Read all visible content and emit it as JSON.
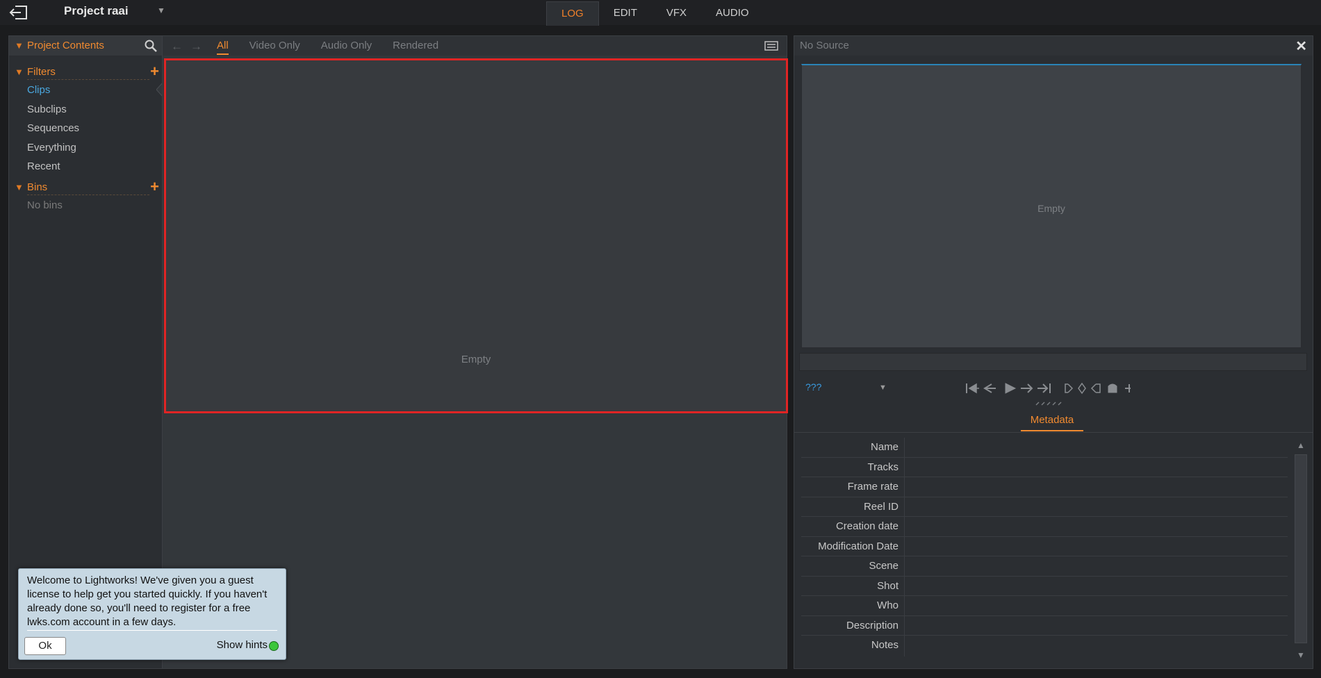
{
  "header": {
    "project_title": "Project raai",
    "tabs": [
      {
        "label": "LOG",
        "active": true
      },
      {
        "label": "EDIT",
        "active": false
      },
      {
        "label": "VFX",
        "active": false
      },
      {
        "label": "AUDIO",
        "active": false
      }
    ]
  },
  "left_panel": {
    "title": "Project Contents",
    "filters_label": "Filters",
    "filter_items": [
      "Clips",
      "Subclips",
      "Sequences",
      "Everything",
      "Recent"
    ],
    "selected_filter": "Clips",
    "bins_label": "Bins",
    "bins_empty": "No bins"
  },
  "browser": {
    "tabs": [
      "All",
      "Video Only",
      "Audio Only",
      "Rendered"
    ],
    "active_tab": "All",
    "empty_text": "Empty"
  },
  "viewer": {
    "title": "No Source",
    "empty_text": "Empty",
    "timecode_mode": "???",
    "metadata_tab": "Metadata",
    "metadata_fields": [
      "Name",
      "Tracks",
      "Frame rate",
      "Reel ID",
      "Creation date",
      "Modification Date",
      "Scene",
      "Shot",
      "Who",
      "Description",
      "Notes"
    ]
  },
  "hint": {
    "text": "Welcome to Lightworks!  We've given you a guest license to help get you started quickly.  If you haven't already done so, you'll need to register for a free lwks.com account in a few days.",
    "ok_label": "Ok",
    "show_hints_label": "Show hints"
  },
  "colors": {
    "accent": "#f08a30",
    "selection": "#4aa8e0",
    "highlight_border": "#e02424",
    "hint_indicator": "#3cc63c"
  },
  "icons": [
    "exit-icon",
    "dropdown-icon",
    "search-icon",
    "add-icon",
    "back-arrow-icon",
    "forward-arrow-icon",
    "list-view-icon",
    "close-icon",
    "transport-icons"
  ]
}
